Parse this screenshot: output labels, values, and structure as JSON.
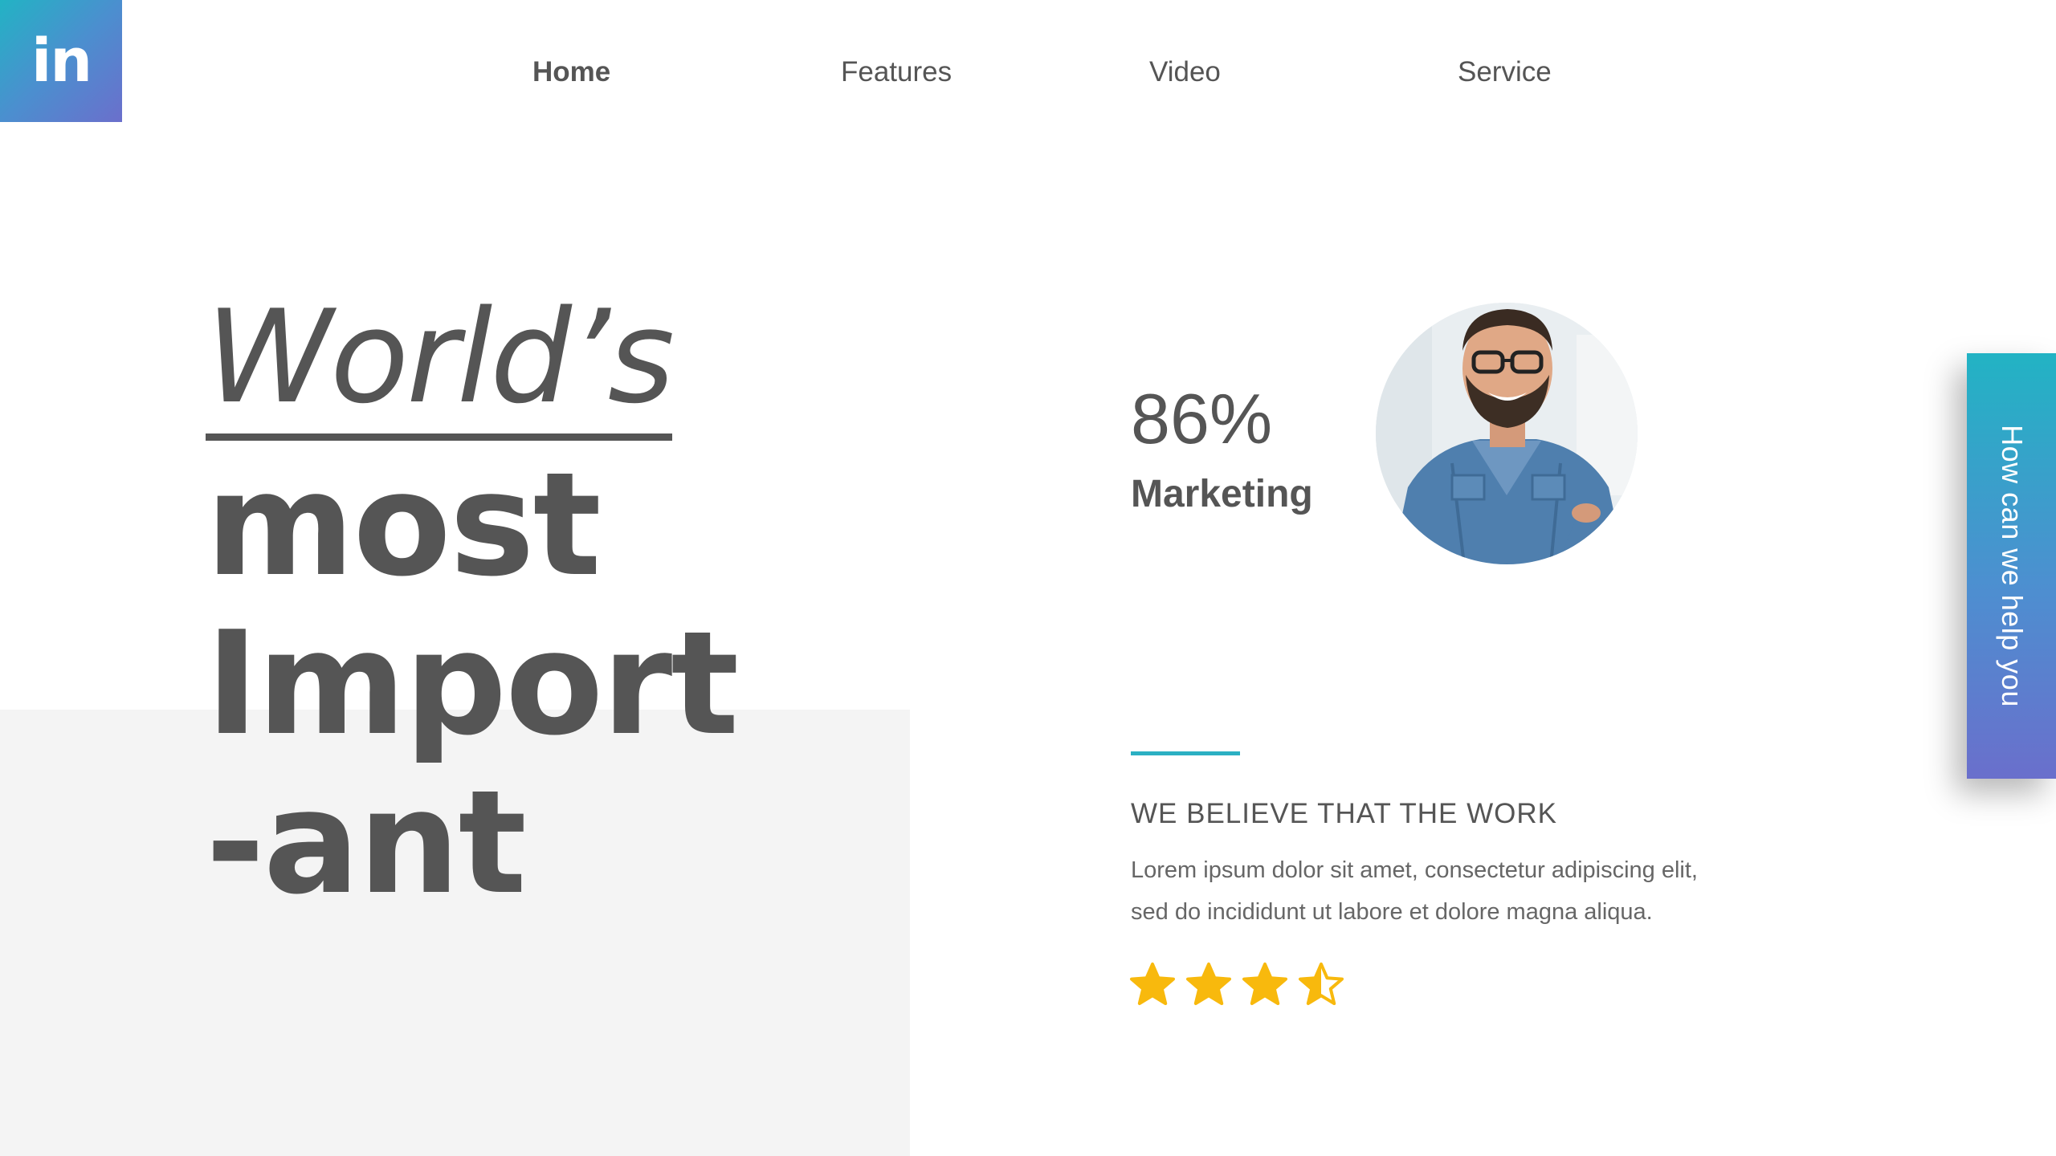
{
  "brand": {
    "logo_text": "in",
    "accent_color": "#2bb0c3",
    "gradient_start": "#22b3c4",
    "gradient_end": "#6a6fcc"
  },
  "nav": {
    "items": [
      {
        "label": "Home",
        "active": true
      },
      {
        "label": "Features",
        "active": false
      },
      {
        "label": "Video",
        "active": false
      },
      {
        "label": "Service",
        "active": false
      }
    ]
  },
  "hero": {
    "line1": "World’s",
    "line2": "most",
    "line3": "Import",
    "line4": "-ant"
  },
  "stat": {
    "value": "86%",
    "label": "Marketing"
  },
  "section": {
    "heading": "WE BELIEVE THAT THE WORK",
    "body_line1": "Lorem ipsum dolor sit amet, consectetur adipiscing elit,",
    "body_line2": "sed do incididunt ut labore et dolore magna aliqua."
  },
  "rating": {
    "value": 3.5,
    "max": 5,
    "shown_stars": 4,
    "color": "#f8b90d"
  },
  "side_tab": {
    "label": "How can we help you"
  }
}
